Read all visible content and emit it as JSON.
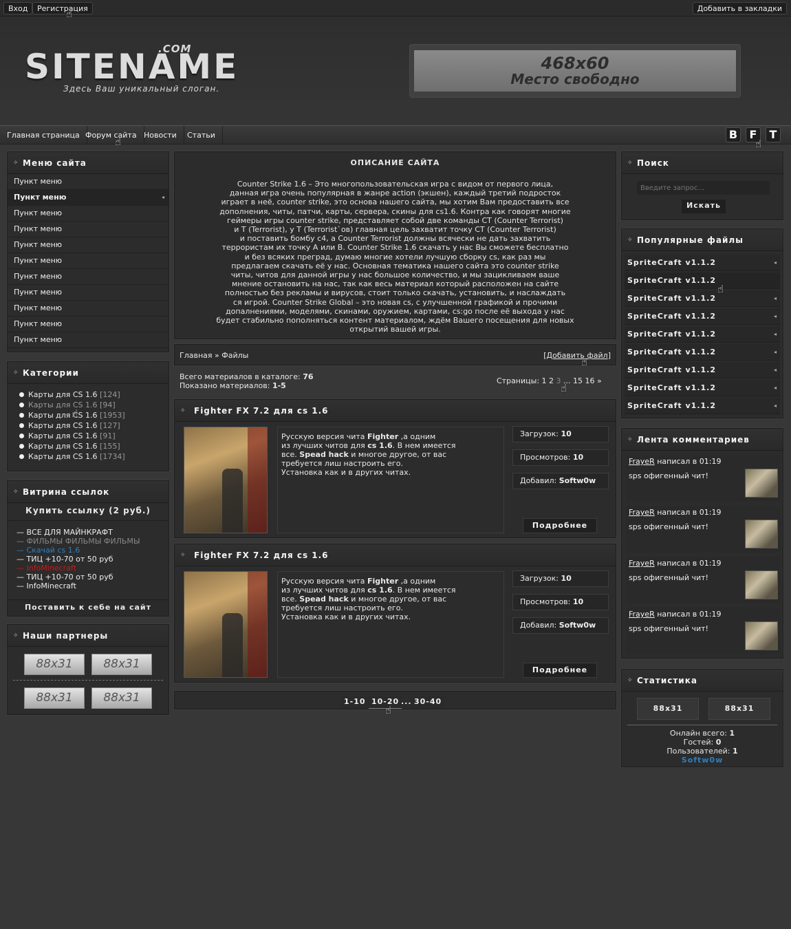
{
  "topbar": {
    "login": "Вход",
    "register": "Регистрация",
    "bookmark": "Добавить в закладки"
  },
  "header": {
    "logo": "SITENAME",
    "logo_tld": ".COM",
    "slogan": "Здесь Ваш уникальный слоган.",
    "banner_size": "468x60",
    "banner_text": "Место свободно"
  },
  "nav": {
    "items": [
      "Главная страница",
      "Форум сайта",
      "Новости",
      "Статьи"
    ],
    "social": [
      "B",
      "F",
      "T"
    ]
  },
  "left": {
    "menu_title": "Меню сайта",
    "menu_items": [
      "Пункт меню",
      "Пункт меню",
      "Пункт меню",
      "Пункт меню",
      "Пункт меню",
      "Пункт меню",
      "Пункт меню",
      "Пункт меню",
      "Пункт меню",
      "Пункт меню",
      "Пункт меню"
    ],
    "categories_title": "Категории",
    "categories": [
      {
        "name": "Карты для CS 1.6",
        "count": "[124]"
      },
      {
        "name": "Карты для CS 1.6",
        "count": "[94]"
      },
      {
        "name": "Карты для CS 1.6",
        "count": "[1953]"
      },
      {
        "name": "Карты для CS 1.6",
        "count": "[127]"
      },
      {
        "name": "Карты для CS 1.6",
        "count": "[91]"
      },
      {
        "name": "Карты для CS 1.6",
        "count": "[155]"
      },
      {
        "name": "Карты для CS 1.6",
        "count": "[1734]"
      }
    ],
    "links_title": "Витрина ссылок",
    "buy_link": "Купить ссылку (2 руб.)",
    "links": [
      {
        "text": "— ВСЕ ДЛЯ МАЙНКРАФТ",
        "color": "#eeeeee"
      },
      {
        "text": "— ФИЛЬМЫ ФИЛЬМЫ ФИЛЬМЫ",
        "color": "#888888"
      },
      {
        "text": "— Скачай cs 1.6",
        "color": "#2f7fbf"
      },
      {
        "text": "— ТИЦ +10-70 от 50 руб",
        "color": "#eeeeee"
      },
      {
        "text": "— InfoMinecraft",
        "color": "#c41a1a"
      },
      {
        "text": "— ТИЦ +10-70 от 50 руб",
        "color": "#eeeeee"
      },
      {
        "text": "— InfoMinecraft",
        "color": "#eeeeee"
      }
    ],
    "put_on_site": "Поставить к себе на сайт",
    "partners_title": "Наши партнеры",
    "partner_label": "88x31"
  },
  "center": {
    "desc_title": "ОПИСАНИЕ САЙТА",
    "desc_lines": [
      "Counter Strike 1.6 – Это многопользовательская игра с видом от первого лица,",
      "данная игра очень популярная в жанре action (экшен), каждый третий подросток",
      "играет в неё, counter strike, это основа нашего сайта, мы хотим Вам предоставить все",
      "дополнения, читы, патчи, карты, сервера, скины для cs1.6. Контра как говорят многие",
      "геймеры игры counter strike, представляет собой две команды CT (Counter Terrorist)",
      "и T (Terrorist), у T (Terrorist`ов) главная цель захватит точку CT (Counter Terrorist)",
      "и поставить бомбу с4, а Counter Terrorist должны всячески не дать захватить",
      "террористам их точку А или В. Counter Strike 1.6 скачать у нас Вы сможете бесплатно",
      "и без всяких преград, думаю многие хотели лучшую сборку cs, как раз мы",
      "предлагаем скачать её у нас. Основная тематика нашего сайта это counter strike",
      "читы, читов для данной игры у нас большое количество, и мы зацикливаем ваше",
      "мнение остановить на нас, так как весь материал который расположен на сайте",
      "полностью без рекламы и вирусов, стоит только скачать, установить, и наслаждать",
      "ся игрой. Counter Strike Global – это новая cs, с улучшенной графикой и прочими",
      "допалнениями, моделями, скинами, оружием, картами, cs:go после её выхода у нас",
      "будет стабильно пополняться контент материалом, ждём Вашего посещения для новых",
      "открытий вашей игры."
    ],
    "breadcrumb_home": "Главная",
    "breadcrumb_sep": "»",
    "breadcrumb_current": "Файлы",
    "add_file": "Добавить файл",
    "total_label": "Всего материалов в каталоге:",
    "total_value": "76",
    "shown_label": "Показано материалов:",
    "shown_value": "1-5",
    "pages_label": "Страницы:",
    "pages": [
      "1",
      "2",
      "3",
      "...",
      "15",
      "16",
      "»"
    ],
    "entries": [
      {
        "title": "Fighter FX 7.2 для cs 1.6",
        "desc_lines": [
          [
            "Русскую версия чита ",
            "Fighter",
            " ,а одним"
          ],
          [
            "из лучших читов для ",
            "cs 1.6",
            ". В нем имеется"
          ],
          [
            "все. ",
            "Spead hack",
            " и многое другое, от вас"
          ],
          [
            "требуется лиш настроить его.",
            "",
            ""
          ],
          [
            "Установка как и в других читах.",
            "",
            ""
          ]
        ],
        "downloads_label": "Загрузок:",
        "downloads": "10",
        "views_label": "Просмотров:",
        "views": "10",
        "author_label": "Добавил:",
        "author": "Softw0w",
        "more": "Подробнее"
      },
      {
        "title": "Fighter FX 7.2 для cs 1.6",
        "desc_lines": [
          [
            "Русскую версия чита ",
            "Fighter",
            " ,а одним"
          ],
          [
            "из лучших читов для ",
            "cs 1.6",
            ". В нем имеется"
          ],
          [
            "все. ",
            "Spead hack",
            " и многое другое, от вас"
          ],
          [
            "требуется лиш настроить его.",
            "",
            ""
          ],
          [
            "Установка как и в других читах.",
            "",
            ""
          ]
        ],
        "downloads_label": "Загрузок:",
        "downloads": "10",
        "views_label": "Просмотров:",
        "views": "10",
        "author_label": "Добавил:",
        "author": "Softw0w",
        "more": "Подробнее"
      }
    ],
    "pagination": [
      "1-10",
      "10-20",
      "...",
      "30-40"
    ]
  },
  "right": {
    "search_title": "Поиск",
    "search_placeholder": "Введите запрос...",
    "search_button": "Искать",
    "popular_title": "Популярные файлы",
    "popular_items": [
      "SpriteCraft v1.1.2",
      "SpriteCraft v1.1.2",
      "SpriteCraft v1.1.2",
      "SpriteCraft v1.1.2",
      "SpriteCraft v1.1.2",
      "SpriteCraft v1.1.2",
      "SpriteCraft v1.1.2",
      "SpriteCraft v1.1.2",
      "SpriteCraft v1.1.2"
    ],
    "comments_title": "Лента комментариев",
    "comments": [
      {
        "user": "FrayeR",
        "meta": " написал в 01:19",
        "text": "sps офигенный чит!"
      },
      {
        "user": "FrayeR",
        "meta": " написал в 01:19",
        "text": "sps офигенный чит!"
      },
      {
        "user": "FrayeR",
        "meta": " написал в 01:19",
        "text": "sps офигенный чит!"
      },
      {
        "user": "FrayeR",
        "meta": " написал в 01:19",
        "text": "sps офигенный чит!"
      }
    ],
    "stats_title": "Статистика",
    "counter_label": "88x31",
    "online_label": "Онлайн всего:",
    "online": "1",
    "guests_label": "Гостей:",
    "guests": "0",
    "users_label": "Пользователей:",
    "users": "1",
    "user_name": "Softw0w"
  },
  "colors": {
    "background": "#373737",
    "block": "#2c2c2c",
    "link_blue": "#2f7fbf",
    "link_red": "#c41a1a"
  }
}
